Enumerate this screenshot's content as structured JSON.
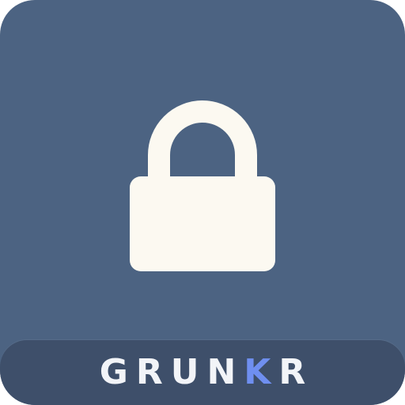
{
  "brand": {
    "background_color": "#4C6382",
    "band_color": "#3E4F6A",
    "lock_color": "#FCF9F1",
    "accent_color": "#6F8FF0",
    "icon": "padlock-icon",
    "wordmark": {
      "part1": "GRUN",
      "accent": "K",
      "part2": "R"
    }
  }
}
